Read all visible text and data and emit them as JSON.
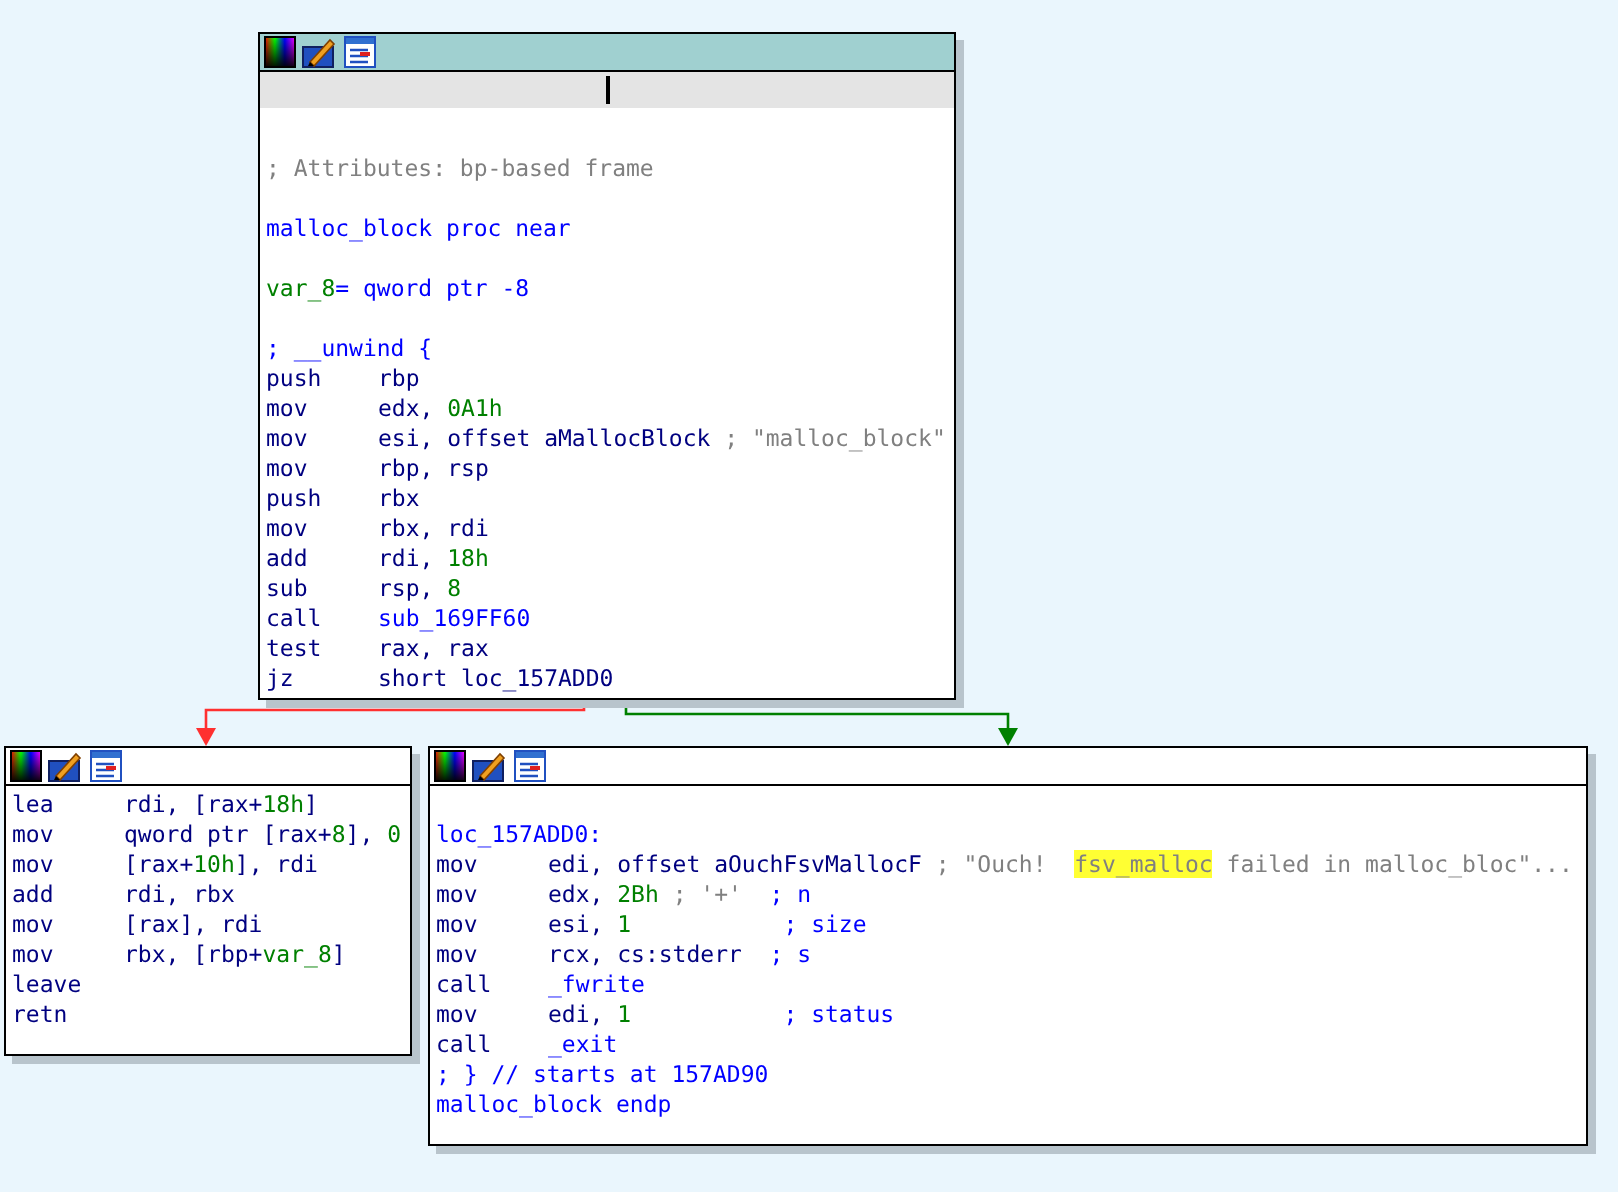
{
  "nodes": [
    {
      "kind": "entry",
      "lines": [
        {
          "kind": "blank"
        },
        {
          "kind": "text",
          "tokens": [
            {
              "text": "; Attributes: bp-based frame",
              "kind": "str"
            }
          ]
        },
        {
          "kind": "blank"
        },
        {
          "kind": "text",
          "tokens": [
            {
              "text": "malloc_block proc near",
              "kind": "sym"
            }
          ]
        },
        {
          "kind": "blank"
        },
        {
          "kind": "text",
          "tokens": [
            {
              "text": "var_8",
              "kind": "num"
            },
            {
              "text": "= qword ptr -8",
              "kind": "sym"
            }
          ]
        },
        {
          "kind": "blank"
        },
        {
          "kind": "text",
          "tokens": [
            {
              "text": "; __unwind {",
              "kind": "sym"
            }
          ]
        },
        {
          "kind": "code",
          "mnem": "push",
          "tokens": [
            {
              "text": "rbp",
              "kind": "reg"
            }
          ]
        },
        {
          "kind": "code",
          "mnem": "mov",
          "tokens": [
            {
              "text": "edx, ",
              "kind": "reg"
            },
            {
              "text": "0A1h",
              "kind": "num"
            }
          ]
        },
        {
          "kind": "code",
          "mnem": "mov",
          "tokens": [
            {
              "text": "esi, offset aMallocBlock ",
              "kind": "reg"
            },
            {
              "text": "; \"malloc_block\"",
              "kind": "str"
            }
          ]
        },
        {
          "kind": "code",
          "mnem": "mov",
          "tokens": [
            {
              "text": "rbp, rsp",
              "kind": "reg"
            }
          ]
        },
        {
          "kind": "code",
          "mnem": "push",
          "tokens": [
            {
              "text": "rbx",
              "kind": "reg"
            }
          ]
        },
        {
          "kind": "code",
          "mnem": "mov",
          "tokens": [
            {
              "text": "rbx, rdi",
              "kind": "reg"
            }
          ]
        },
        {
          "kind": "code",
          "mnem": "add",
          "tokens": [
            {
              "text": "rdi, ",
              "kind": "reg"
            },
            {
              "text": "18h",
              "kind": "num"
            }
          ]
        },
        {
          "kind": "code",
          "mnem": "sub",
          "tokens": [
            {
              "text": "rsp, ",
              "kind": "reg"
            },
            {
              "text": "8",
              "kind": "num"
            }
          ]
        },
        {
          "kind": "code",
          "mnem": "call",
          "tokens": [
            {
              "text": "sub_169FF60",
              "kind": "sym"
            }
          ]
        },
        {
          "kind": "code",
          "mnem": "test",
          "tokens": [
            {
              "text": "rax, rax",
              "kind": "reg"
            }
          ]
        },
        {
          "kind": "code",
          "mnem": "jz",
          "tokens": [
            {
              "text": "short loc_157ADD0",
              "kind": "reg"
            }
          ]
        }
      ]
    },
    {
      "kind": "plain",
      "lines": [
        {
          "kind": "code",
          "mnem": "lea",
          "tokens": [
            {
              "text": "rdi, [rax+",
              "kind": "reg"
            },
            {
              "text": "18h",
              "kind": "num"
            },
            {
              "text": "]",
              "kind": "reg"
            }
          ]
        },
        {
          "kind": "code",
          "mnem": "mov",
          "tokens": [
            {
              "text": "qword ptr [rax+",
              "kind": "reg"
            },
            {
              "text": "8",
              "kind": "num"
            },
            {
              "text": "], ",
              "kind": "reg"
            },
            {
              "text": "0",
              "kind": "num"
            }
          ]
        },
        {
          "kind": "code",
          "mnem": "mov",
          "tokens": [
            {
              "text": "[rax+",
              "kind": "reg"
            },
            {
              "text": "10h",
              "kind": "num"
            },
            {
              "text": "], rdi",
              "kind": "reg"
            }
          ]
        },
        {
          "kind": "code",
          "mnem": "add",
          "tokens": [
            {
              "text": "rdi, rbx",
              "kind": "reg"
            }
          ]
        },
        {
          "kind": "code",
          "mnem": "mov",
          "tokens": [
            {
              "text": "[rax], rdi",
              "kind": "reg"
            }
          ]
        },
        {
          "kind": "code",
          "mnem": "mov",
          "tokens": [
            {
              "text": "rbx, [rbp+",
              "kind": "reg"
            },
            {
              "text": "var_8",
              "kind": "num"
            },
            {
              "text": "]",
              "kind": "reg"
            }
          ]
        },
        {
          "kind": "code",
          "mnem": "leave"
        },
        {
          "kind": "code",
          "mnem": "retn"
        }
      ]
    },
    {
      "kind": "plain",
      "lines": [
        {
          "kind": "blank"
        },
        {
          "kind": "text",
          "tokens": [
            {
              "text": "loc_157ADD0:",
              "kind": "sym"
            }
          ]
        },
        {
          "kind": "code",
          "mnem": "mov",
          "tokens": [
            {
              "text": "edi, offset aOuchFsvMallocF ",
              "kind": "reg"
            },
            {
              "text": "; \"Ouch!  ",
              "kind": "str"
            },
            {
              "text": "fsv_malloc",
              "kind": "hl"
            },
            {
              "text": " failed in malloc_bloc\"...",
              "kind": "str"
            }
          ]
        },
        {
          "kind": "code",
          "mnem": "mov",
          "tokens": [
            {
              "text": "edx, ",
              "kind": "reg"
            },
            {
              "text": "2Bh",
              "kind": "num"
            },
            {
              "text": " ; '+'",
              "kind": "str"
            },
            {
              "text": "  ; n",
              "kind": "sym"
            }
          ]
        },
        {
          "kind": "code",
          "mnem": "mov",
          "tokens": [
            {
              "text": "esi, ",
              "kind": "reg"
            },
            {
              "text": "1",
              "kind": "num"
            },
            {
              "text": "           ; size",
              "kind": "sym"
            }
          ]
        },
        {
          "kind": "code",
          "mnem": "mov",
          "tokens": [
            {
              "text": "rcx, cs:stderr  ",
              "kind": "reg"
            },
            {
              "text": "; s",
              "kind": "sym"
            }
          ]
        },
        {
          "kind": "code",
          "mnem": "call",
          "tokens": [
            {
              "text": "_fwrite",
              "kind": "sym"
            }
          ]
        },
        {
          "kind": "code",
          "mnem": "mov",
          "tokens": [
            {
              "text": "edi, ",
              "kind": "reg"
            },
            {
              "text": "1",
              "kind": "num"
            },
            {
              "text": "           ; status",
              "kind": "sym"
            }
          ]
        },
        {
          "kind": "code",
          "mnem": "call",
          "tokens": [
            {
              "text": "_exit",
              "kind": "sym"
            }
          ]
        },
        {
          "kind": "text",
          "tokens": [
            {
              "text": "; } // starts at 157AD90",
              "kind": "sym"
            }
          ]
        },
        {
          "kind": "text",
          "tokens": [
            {
              "text": "malloc_block endp",
              "kind": "sym"
            }
          ]
        }
      ]
    }
  ],
  "edges": [
    {
      "color": "#ff3030"
    },
    {
      "color": "#008000"
    }
  ]
}
